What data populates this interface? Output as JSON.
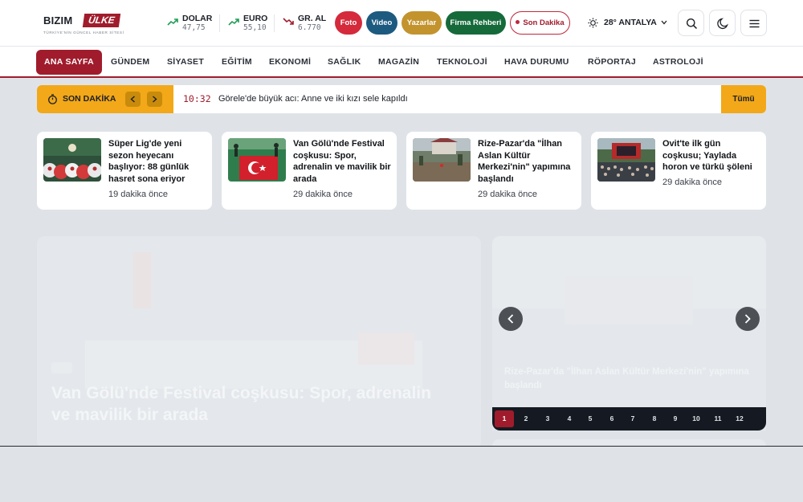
{
  "logo": {
    "word1": "BIZIM",
    "word2": "ÜLKE",
    "tagline": "TÜRKİYE'NİN GÜNCEL HABER SİTESİ"
  },
  "currencies": [
    {
      "name": "DOLAR",
      "value": "47,75",
      "trend": "up"
    },
    {
      "name": "EURO",
      "value": "55,10",
      "trend": "up"
    },
    {
      "name": "GR. AL",
      "value": "6.770",
      "trend": "down"
    }
  ],
  "header_buttons": [
    {
      "label": "Foto",
      "color": "#d42a3c"
    },
    {
      "label": "Video",
      "color": "#1d5a80"
    },
    {
      "label": "Yazarlar",
      "color": "#c3932e"
    },
    {
      "label": "Firma Rehberi",
      "color": "#166a3a"
    },
    {
      "label": "Son Dakika",
      "color": "#ffffff"
    }
  ],
  "weather": {
    "text": "28° ANTALYA"
  },
  "nav": [
    "ANA SAYFA",
    "GÜNDEM",
    "SİYASET",
    "EĞİTİM",
    "EKONOMİ",
    "SAĞLIK",
    "MAGAZİN",
    "TEKNOLOJİ",
    "HAVA DURUMU",
    "RÖPORTAJ",
    "ASTROLOJİ"
  ],
  "breaking": {
    "label": "SON DAKİKA",
    "time": "10:32",
    "text": "Görele'de büyük acı: Anne ve iki kızı sele kapıldı",
    "all": "Tümü"
  },
  "cards": [
    {
      "title": "Süper Lig'de yeni sezon heyecanı başlıyor: 88 günlük hasret sona eriyor",
      "time": "19 dakika önce"
    },
    {
      "title": "Van Gölü'nde Festival coşkusu: Spor, adrenalin ve mavilik bir arada",
      "time": "29 dakika önce"
    },
    {
      "title": "Rize-Pazar'da \"İlhan Aslan Kültür Merkezi'nin\" yapımına başlandı",
      "time": "29 dakika önce"
    },
    {
      "title": "Ovit'te ilk gün coşkusu; Yaylada horon ve türkü şöleni",
      "time": "29 dakika önce"
    }
  ],
  "main_slide": {
    "headline": "Van Gölü'nde Festival coşkusu: Spor, adrenalin ve mavilik bir arada"
  },
  "side_slide": {
    "caption": "Rize-Pazar'da \"İlhan Aslan Kültür Merkezi'nin\" yapımına başlandı"
  },
  "pager": [
    "1",
    "2",
    "3",
    "4",
    "5",
    "6",
    "7",
    "8",
    "9",
    "10",
    "11",
    "12"
  ],
  "colors": {
    "brand": "#a01c2c",
    "accent": "#f2a818",
    "up": "#1f9d55",
    "down": "#a01c2c"
  }
}
